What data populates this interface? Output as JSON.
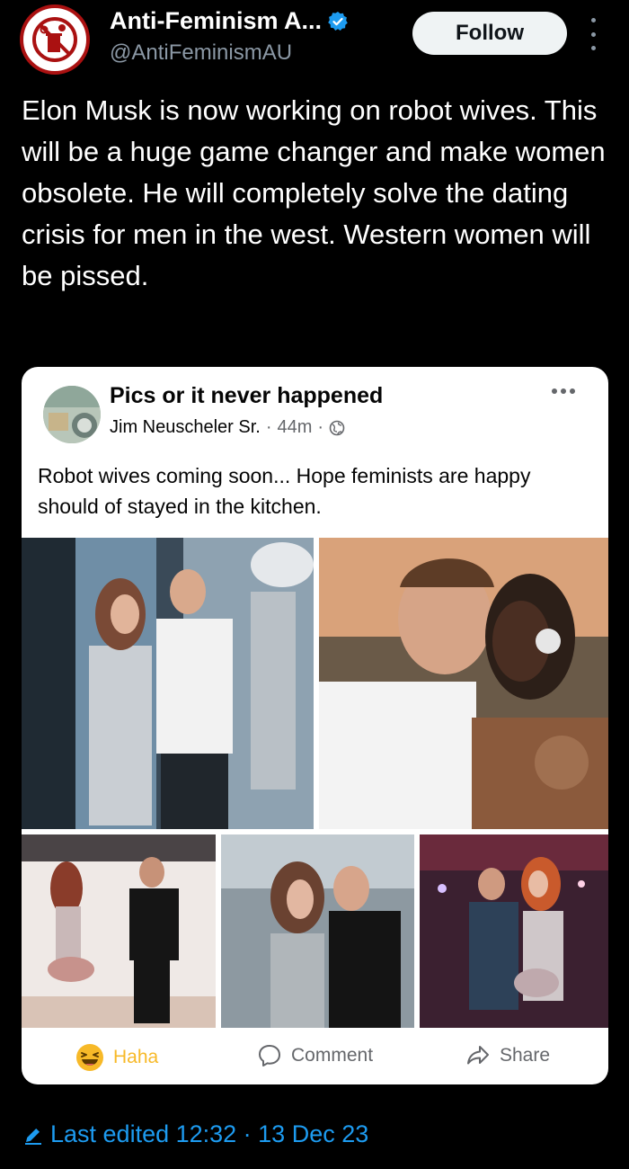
{
  "post": {
    "display_name": "Anti-Feminism A...",
    "handle": "@AntiFeminismAU",
    "follow_label": "Follow",
    "text": "Elon Musk is now working on robot wives. This will be a huge game changer and make women obsolete. He will completely solve the dating crisis for men in the west. Western women will be pissed."
  },
  "embedded_post": {
    "group_name": "Pics or it never happened",
    "author": "Jim Neuscheler Sr.",
    "separator1": "·",
    "time": "44m",
    "separator2": "·",
    "text": "Robot wives coming soon... Hope feminists are happy should of stayed in the kitchen.",
    "reactions": {
      "haha_label": "Haha",
      "comment_label": "Comment",
      "share_label": "Share"
    }
  },
  "footer": {
    "edited_text": "Last edited 12:32 · 13 Dec 23"
  },
  "colors": {
    "accent_blue": "#1d9bf0",
    "haha_yellow": "#f7b928",
    "avatar_red": "#aa1111"
  },
  "icons": [
    "anti-feminism-logo-icon",
    "verified-badge-icon",
    "more-vertical-icon",
    "group-avatar-icon",
    "globe-icon",
    "more-horizontal-icon",
    "haha-emoji-icon",
    "comment-icon",
    "share-icon",
    "pencil-icon"
  ]
}
